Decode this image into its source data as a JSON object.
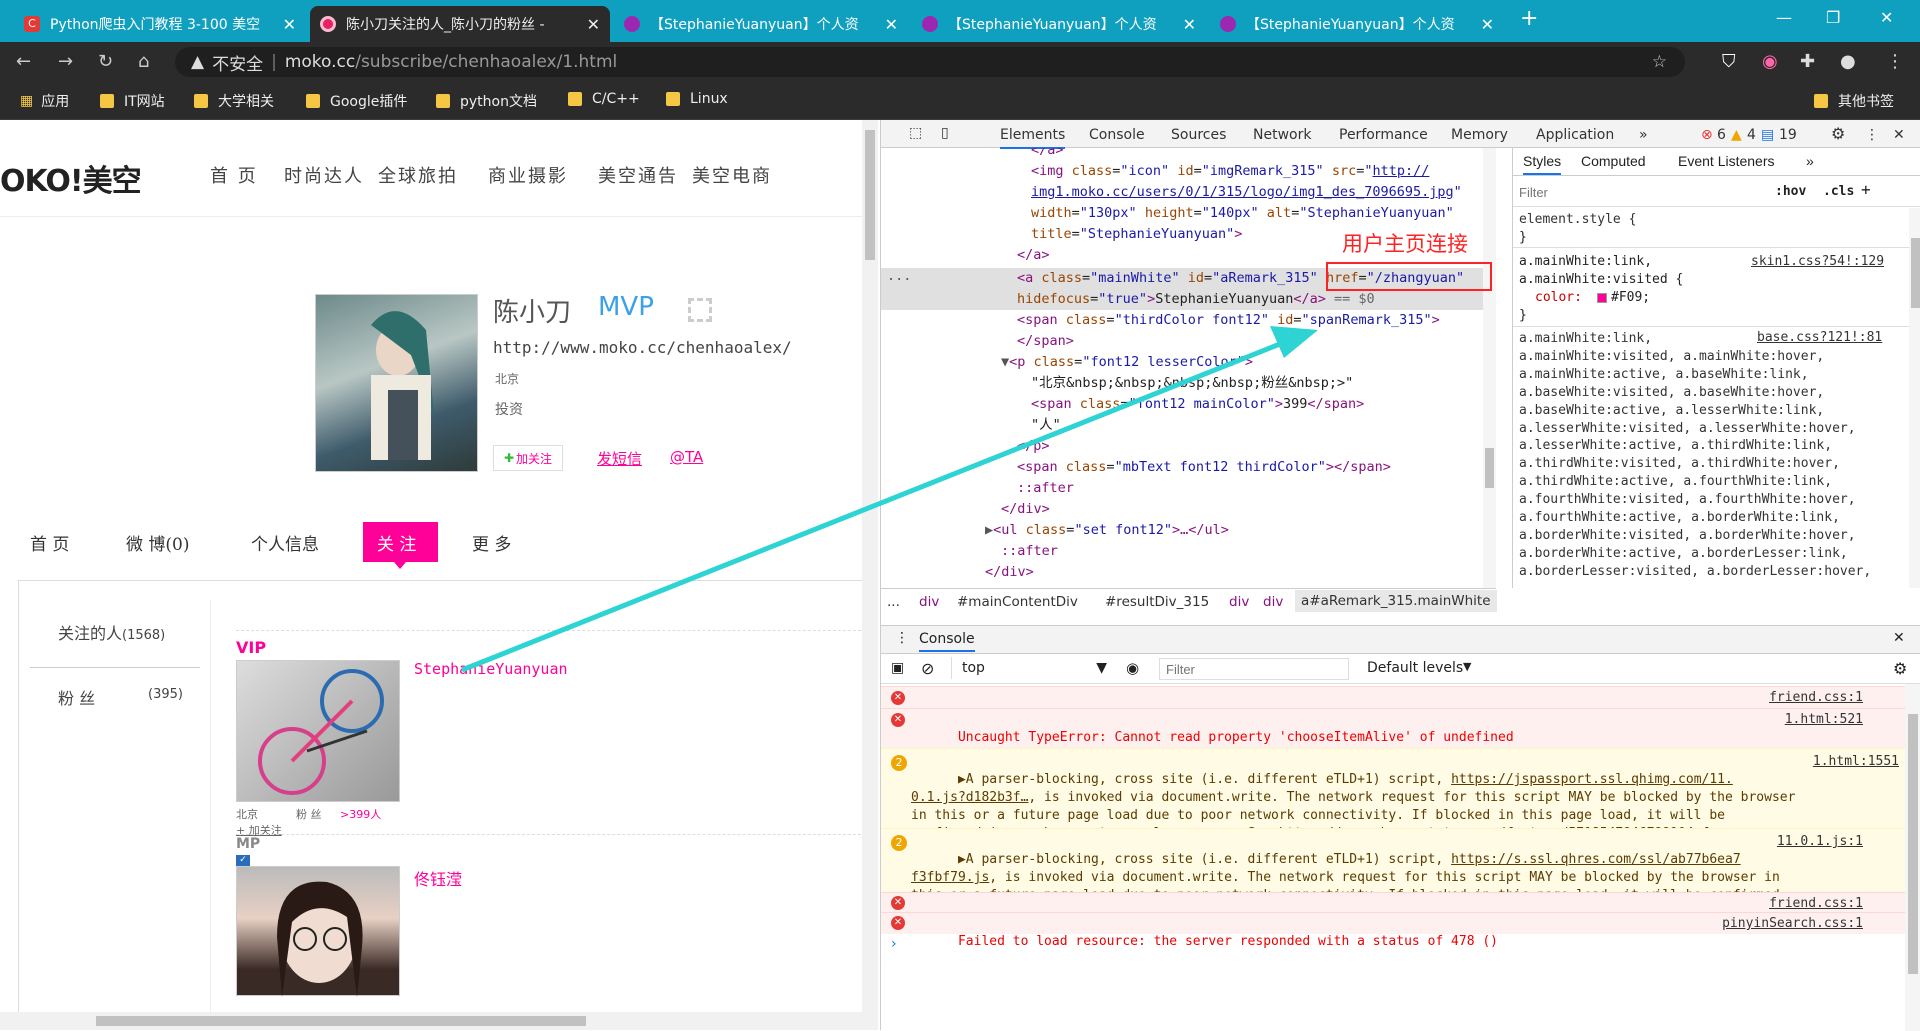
{
  "browser": {
    "tabs": [
      {
        "title": "Python爬虫入门教程 3-100 美空",
        "active": false
      },
      {
        "title": "陈小刀关注的人_陈小刀的粉丝 -",
        "active": true
      },
      {
        "title": "【StephanieYuanyuan】个人资",
        "active": false
      },
      {
        "title": "【StephanieYuanyuan】个人资",
        "active": false
      },
      {
        "title": "【StephanieYuanyuan】个人资",
        "active": false
      }
    ],
    "security_label": "不安全",
    "url_host": "moko.cc",
    "url_path": "/subscribe/chenhaoalex/1.html",
    "bookmarks": [
      "应用",
      "IT网站",
      "大学相关",
      "Google插件",
      "python文档",
      "C/C++",
      "Linux"
    ],
    "other_bookmarks": "其他书签"
  },
  "page": {
    "logo": "OKO!美空",
    "nav": [
      "首 页",
      "时尚达人",
      "全球旅拍",
      "商业摄影",
      "美空通告",
      "美空电商"
    ],
    "profile": {
      "name": "陈小刀",
      "badge": "MVP",
      "url": "http://www.moko.cc/chenhaoalex/",
      "city": "北京",
      "role": "投资",
      "follow_btn": "加关注",
      "message_link": "发短信",
      "at_link": "@TA"
    },
    "profile_tabs": [
      "首 页",
      "微 博(0)",
      "个人信息",
      "关 注",
      "更 多"
    ],
    "sidebar": {
      "following_label": "关注的人",
      "following_count": "(1568)",
      "fans_label": "粉 丝",
      "fans_count": "(395)"
    },
    "list": [
      {
        "tag": "VIP",
        "name": "StephanieYuanyuan",
        "city": "北京",
        "fans_label": "粉 丝",
        "fans_count": ">399人",
        "follow": "+ 加关注"
      },
      {
        "tag": "MP",
        "name": "佟钰滢"
      }
    ]
  },
  "annotation": {
    "label": "用户主页连接",
    "color": "#ff2222",
    "arrow_color": "#2ed3d3"
  },
  "devtools": {
    "tabs": [
      "Elements",
      "Console",
      "Sources",
      "Network",
      "Performance",
      "Memory",
      "Application"
    ],
    "error_count": "6",
    "warning_count": "4",
    "info_count": "19",
    "breadcrumbs": [
      "...",
      "div",
      "#mainContentDiv",
      "#resultDiv_315",
      "div",
      "div",
      "a#aRemark_315.mainWhite"
    ],
    "styles_tabs": [
      "Styles",
      "Computed",
      "Event Listeners"
    ],
    "filter_placeholder": "Filter",
    "hov": ":hov",
    "cls": ".cls",
    "element_style": "element.style {",
    "rule1_selector1": "a.mainWhite:link,",
    "rule1_selector2": "a.mainWhite:visited {",
    "rule1_src": "skin1.css?54!:129",
    "rule1_prop": "color:",
    "rule1_value": "#F09;",
    "rule2_src": "base.css?121!:81",
    "rule2_selectors": [
      "a.mainWhite:link,",
      "a.mainWhite:visited, a.mainWhite:hover,",
      "a.mainWhite:active, a.baseWhite:link,",
      "a.baseWhite:visited, a.baseWhite:hover,",
      "a.baseWhite:active, a.lesserWhite:link,",
      "a.lesserWhite:visited, a.lesserWhite:hover,",
      "a.lesserWhite:active, a.thirdWhite:link,",
      "a.thirdWhite:visited, a.thirdWhite:hover,",
      "a.thirdWhite:active, a.fourthWhite:link,",
      "a.fourthWhite:visited, a.fourthWhite:hover,",
      "a.fourthWhite:active, a.borderWhite:link,",
      "a.borderWhite:visited, a.borderWhite:hover,",
      "a.borderWhite:active, a.borderLesser:link,",
      "a.borderLesser:visited, a.borderLesser:hover,"
    ],
    "console_label": "Console",
    "context": "top",
    "default_levels": "Default levels"
  }
}
